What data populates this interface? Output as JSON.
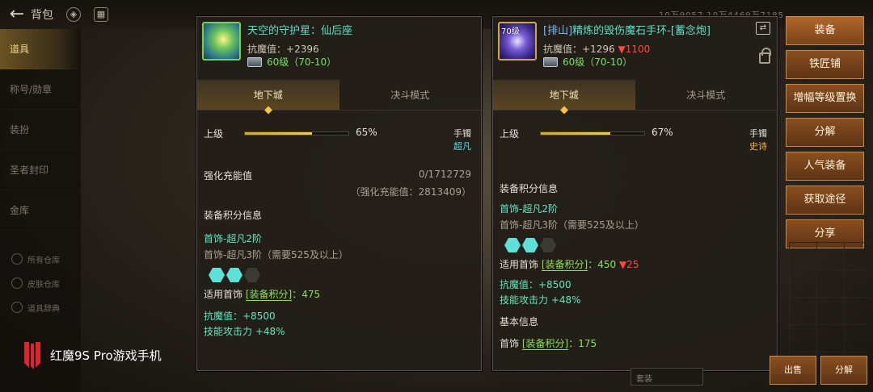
{
  "topbar": {
    "title": "背包",
    "stats": "10万9057  10万4469万7185"
  },
  "sidebar": {
    "items": [
      "道具",
      "称号/勋章",
      "装扮",
      "圣者封印",
      "金库"
    ],
    "sub_items": [
      "所有仓库",
      "皮肤仓库",
      "道具辞典"
    ]
  },
  "watermark": {
    "text": "红魔9S Pro游戏手机"
  },
  "left_panel": {
    "badge": "",
    "name": "天空的守护星：仙后座",
    "stat_label": "抗魔值",
    "stat_value": "+2396",
    "level": "60级（70-10）",
    "tabs": [
      "地下城",
      "决斗模式"
    ],
    "rank": {
      "label": "上级",
      "percent_text": "65%",
      "percent": 65,
      "type": "手镯",
      "grade": "超凡"
    },
    "charge_label": "强化充能值",
    "charge_value": "0/1712729",
    "charge_sub": "（强化充能值：2813409）",
    "score_title": "装备积分信息",
    "score_line1": "首饰-超凡2阶",
    "score_line2": "首饰-超凡3阶（需要525及以上）",
    "applies": "适用首饰",
    "bracket": "[装备积分]",
    "score_value": "：475",
    "stat1": "抗魔值：+8500",
    "stat2": "技能攻击力 +48%"
  },
  "right_panel": {
    "badge": "70级",
    "tag": "[排山]",
    "name": "精炼的毁伤魔石手环-[蓄念炮]",
    "stat_label": "抗魔值",
    "stat_value": "+1296",
    "stat_down": "▼1100",
    "level": "60级（70-10）",
    "tabs": [
      "地下城",
      "决斗模式"
    ],
    "rank": {
      "label": "上级",
      "percent_text": "67%",
      "percent": 67,
      "type": "手镯",
      "grade": "史诗"
    },
    "score_title": "装备积分信息",
    "score_line1": "首饰-超凡2阶",
    "score_line2": "首饰-超凡3阶（需要525及以上）",
    "applies": "适用首饰",
    "bracket": "[装备积分]",
    "score_value": "：450",
    "score_down": "▼25",
    "stat1": "抗魔值：+8500",
    "stat2": "技能攻击力 +48%",
    "basic_title": "基本信息",
    "basic_applies": "首饰",
    "basic_bracket": "[装备积分]",
    "basic_value": "：175"
  },
  "menu": [
    "装备",
    "铁匠铺",
    "增幅等级置换",
    "分解",
    "人气装备",
    "获取途径",
    "分享"
  ],
  "bottom": {
    "sell": "出售",
    "decompose": "分解",
    "select": "套装"
  }
}
